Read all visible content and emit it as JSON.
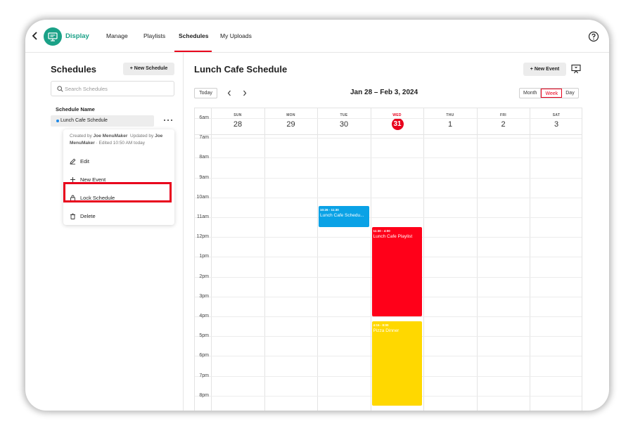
{
  "brand": {
    "name": "Display"
  },
  "nav": {
    "items": [
      "Manage",
      "Playlists",
      "Schedules",
      "My Uploads"
    ],
    "active": "Schedules"
  },
  "sidebar": {
    "title": "Schedules",
    "new_button": "+ New Schedule",
    "search_placeholder": "Search Schedules",
    "column_label": "Schedule Name",
    "selected_item": "Lunch Cafe Schedule",
    "context_menu": {
      "meta_created_prefix": "Created by",
      "meta_creator": "Joe MenuMaker",
      "meta_updated_prefix": "Updated by",
      "meta_updater": "Joe MenuMaker",
      "meta_edited": "· Edited 10:50 AM today",
      "items": [
        {
          "label": "Edit",
          "icon": "pencil-icon",
          "highlighted": true
        },
        {
          "label": "New Event",
          "icon": "plus-icon"
        },
        {
          "label": "Lock Schedule",
          "icon": "lock-icon"
        },
        {
          "label": "Delete",
          "icon": "trash-icon"
        }
      ]
    }
  },
  "main": {
    "title": "Lunch Cafe Schedule",
    "new_event_button": "+ New Event",
    "today_button": "Today",
    "date_range": "Jan 28 – Feb 3, 2024",
    "views": [
      "Month",
      "Week",
      "Day"
    ],
    "active_view": "Week"
  },
  "calendar": {
    "days": [
      {
        "dow": "SUN",
        "date": "28"
      },
      {
        "dow": "MON",
        "date": "29"
      },
      {
        "dow": "TUE",
        "date": "30"
      },
      {
        "dow": "WED",
        "date": "31",
        "today": true
      },
      {
        "dow": "THU",
        "date": "1"
      },
      {
        "dow": "FRI",
        "date": "2"
      },
      {
        "dow": "SAT",
        "date": "3"
      }
    ],
    "hours": [
      "6am",
      "7am",
      "8am",
      "9am",
      "10am",
      "11am",
      "12pm",
      "1pm",
      "2pm",
      "3pm",
      "4pm",
      "5pm",
      "6pm",
      "7pm",
      "8pm"
    ],
    "events": [
      {
        "day": 2,
        "start": 10.43,
        "end": 11.5,
        "time": "10:26 - 11:30",
        "name": "Lunch Cafe Schedu...",
        "color": "#0aa2e6"
      },
      {
        "day": 3,
        "start": 11.5,
        "end": 16.0,
        "time": "11:30 - 4:00",
        "name": "Lunch Cafe Playlist",
        "color": "#ff0019"
      },
      {
        "day": 3,
        "start": 16.25,
        "end": 20.5,
        "time": "4:15 - 8:00",
        "name": "Pizza Dinner",
        "color": "#ffd800"
      }
    ]
  },
  "colors": {
    "accent": "#e8001c",
    "brand": "#1aa187"
  }
}
